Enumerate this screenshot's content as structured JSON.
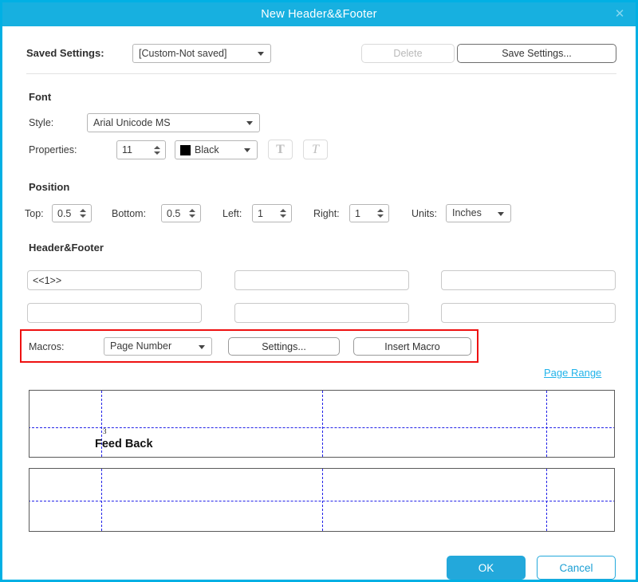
{
  "window": {
    "title": "New Header&&Footer",
    "close_icon": "close-icon",
    "accent_color": "#17b0e0",
    "border_color": "#00b0e4"
  },
  "saved_settings": {
    "label": "Saved Settings:",
    "value": "[Custom-Not saved]",
    "delete_label": "Delete",
    "save_label": "Save Settings..."
  },
  "font": {
    "section_title": "Font",
    "style_label": "Style:",
    "style_value": "Arial Unicode MS",
    "properties_label": "Properties:",
    "size_value": "11",
    "color_value": "Black",
    "color_hex": "#000000",
    "bold_glyph": "T",
    "italic_glyph": "T"
  },
  "position": {
    "section_title": "Position",
    "top_label": "Top:",
    "top_value": "0.5",
    "bottom_label": "Bottom:",
    "bottom_value": "0.5",
    "left_label": "Left:",
    "left_value": "1",
    "right_label": "Right:",
    "right_value": "1",
    "units_label": "Units:",
    "units_value": "Inches"
  },
  "header_footer": {
    "section_title": "Header&Footer",
    "fields": [
      {
        "name": "header-left",
        "value": "<<1>>"
      },
      {
        "name": "header-center",
        "value": ""
      },
      {
        "name": "header-right",
        "value": ""
      },
      {
        "name": "footer-left",
        "value": ""
      },
      {
        "name": "footer-center",
        "value": ""
      },
      {
        "name": "footer-right",
        "value": ""
      }
    ]
  },
  "macros": {
    "label": "Macros:",
    "selected": "Page Number",
    "settings_label": "Settings...",
    "insert_label": "Insert Macro",
    "highlight_color": "#ee1111"
  },
  "page_range": {
    "link_label": "Page Range",
    "link_color": "#21b3ea"
  },
  "preview": {
    "page_number": "3",
    "body_text": "Feed Back",
    "guide_color": "#2323e8"
  },
  "footer": {
    "ok_label": "OK",
    "cancel_label": "Cancel",
    "ok_color": "#23a8db"
  }
}
